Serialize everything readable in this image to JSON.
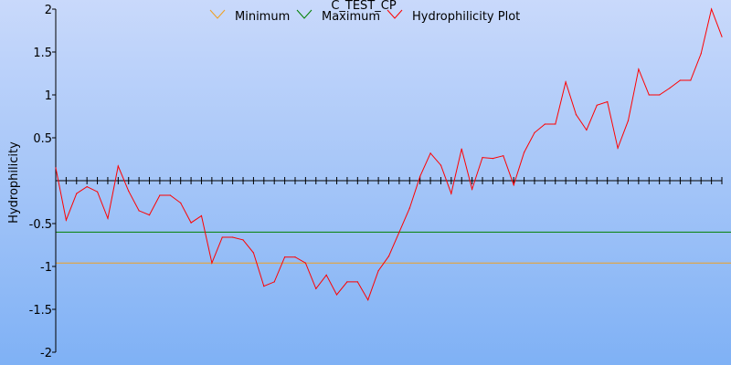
{
  "chart_data": {
    "type": "line",
    "title": "C_TEST_CP",
    "xlabel": "",
    "ylabel": "Hydrophilicity",
    "ylim": [
      -2,
      2
    ],
    "yticks": [
      {
        "value": 2,
        "label": "2"
      },
      {
        "value": 1.5,
        "label": "1.5"
      },
      {
        "value": 1,
        "label": "1"
      },
      {
        "value": 0.5,
        "label": "0.5"
      },
      {
        "value": -0.5,
        "label": "-0.5"
      },
      {
        "value": -1,
        "label": "-1"
      },
      {
        "value": -1.5,
        "label": "-1.5"
      },
      {
        "value": -2,
        "label": "-2"
      }
    ],
    "legend_position": "top",
    "legend": [
      {
        "name": "Minimum",
        "color": "#f0a020"
      },
      {
        "name": "Maximum",
        "color": "#008000"
      },
      {
        "name": "Hydrophilicity Plot",
        "color": "#ff0000"
      }
    ],
    "thresholds": {
      "minimum": -0.96,
      "maximum": -0.6
    },
    "series": [
      {
        "name": "Hydrophilicity Plot",
        "color": "#ff0000",
        "values": [
          0.15,
          -0.46,
          -0.15,
          -0.07,
          -0.13,
          -0.44,
          0.17,
          -0.12,
          -0.35,
          -0.4,
          -0.17,
          -0.17,
          -0.26,
          -0.49,
          -0.41,
          -0.96,
          -0.66,
          -0.66,
          -0.69,
          -0.84,
          -1.23,
          -1.18,
          -0.89,
          -0.89,
          -0.96,
          -1.26,
          -1.1,
          -1.33,
          -1.18,
          -1.18,
          -1.39,
          -1.05,
          -0.88,
          -0.6,
          -0.32,
          0.05,
          0.32,
          0.18,
          -0.15,
          0.37,
          -0.1,
          0.27,
          0.26,
          0.29,
          -0.05,
          0.33,
          0.56,
          0.66,
          0.66,
          1.15,
          0.77,
          0.59,
          0.88,
          0.92,
          0.38,
          0.7,
          1.3,
          1.0,
          1.0,
          1.08,
          1.17,
          1.17,
          1.48,
          2.0,
          1.68
        ]
      }
    ]
  }
}
